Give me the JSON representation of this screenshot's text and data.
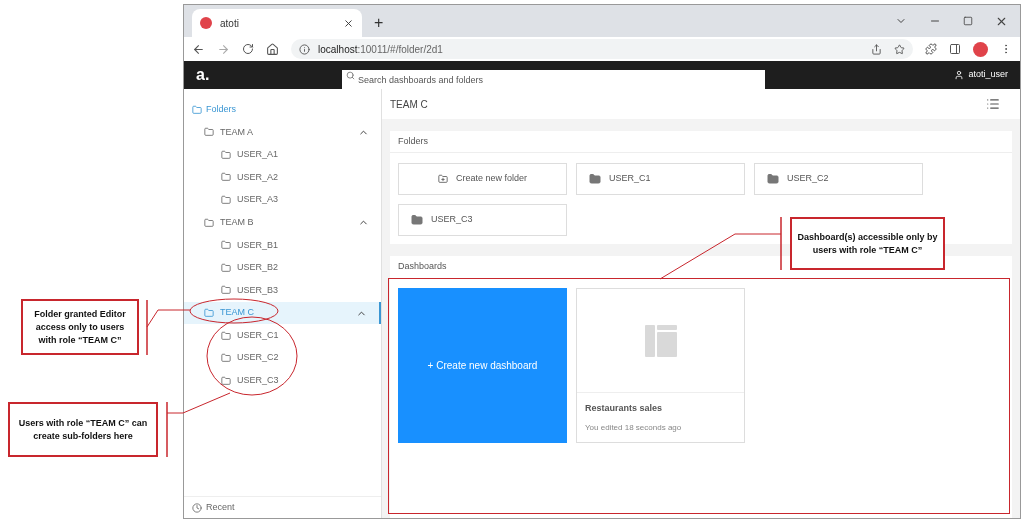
{
  "browser": {
    "tab_title": "atoti",
    "new_tab": "+",
    "url_host": "localhost",
    "url_path": ":10011/#/folder/2d1"
  },
  "app": {
    "logo": "a.",
    "search": {
      "placeholder": "Search dashboards and folders"
    },
    "user": "atoti_user"
  },
  "sidebar": {
    "root": "Folders",
    "items": [
      {
        "label": "TEAM A",
        "expanded": true,
        "selected": false,
        "children": [
          {
            "label": "USER_A1"
          },
          {
            "label": "USER_A2"
          },
          {
            "label": "USER_A3"
          }
        ]
      },
      {
        "label": "TEAM B",
        "expanded": true,
        "selected": false,
        "children": [
          {
            "label": "USER_B1"
          },
          {
            "label": "USER_B2"
          },
          {
            "label": "USER_B3"
          }
        ]
      },
      {
        "label": "TEAM C",
        "expanded": true,
        "selected": true,
        "children": [
          {
            "label": "USER_C1"
          },
          {
            "label": "USER_C2"
          },
          {
            "label": "USER_C3"
          }
        ]
      }
    ],
    "recent": "Recent"
  },
  "main": {
    "title": "TEAM C",
    "folders": {
      "heading": "Folders",
      "cards": [
        {
          "kind": "create",
          "label": "Create new folder"
        },
        {
          "kind": "folder",
          "label": "USER_C1"
        },
        {
          "kind": "folder",
          "label": "USER_C2"
        },
        {
          "kind": "folder",
          "label": "USER_C3"
        }
      ]
    },
    "dashboards": {
      "heading": "Dashboards",
      "cards": [
        {
          "kind": "create",
          "label": "+ Create new dashboard"
        },
        {
          "kind": "dashboard",
          "title": "Restaurants sales",
          "subtitle": "You edited 18 seconds ago"
        }
      ]
    }
  },
  "annotations": [
    {
      "text": "Folder granted Editor access only to users with role “TEAM C”"
    },
    {
      "text": "Users with role “TEAM C” can create sub-folders here"
    },
    {
      "text": "Dashboard(s) accessible only by users with role “TEAM C”"
    }
  ]
}
